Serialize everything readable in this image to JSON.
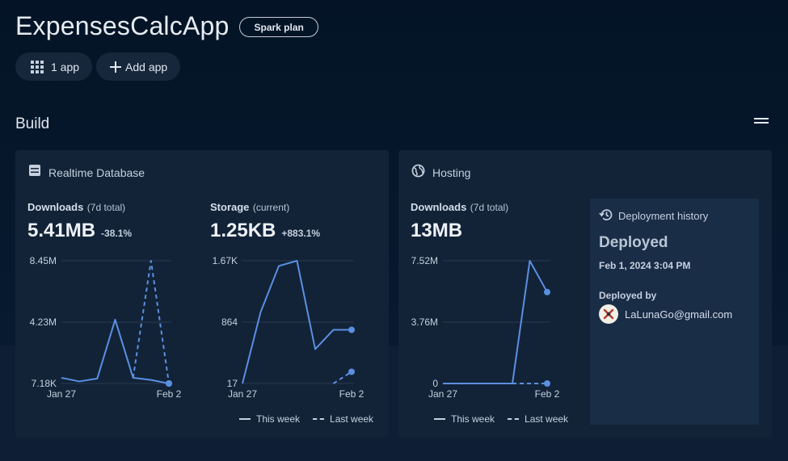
{
  "project": {
    "title": "ExpensesCalcApp",
    "plan": "Spark plan"
  },
  "pills": {
    "apps_label": "1 app",
    "add_label": "Add app"
  },
  "section": {
    "title": "Build"
  },
  "rtdb": {
    "title": "Realtime Database",
    "downloads": {
      "name": "Downloads",
      "sub": "(7d total)",
      "value": "5.41MB",
      "change": "-38.1%"
    },
    "storage": {
      "name": "Storage",
      "sub": "(current)",
      "value": "1.25KB",
      "change": "+883.1%"
    },
    "legend": {
      "this_week": "This week",
      "last_week": "Last week"
    }
  },
  "hosting": {
    "title": "Hosting",
    "downloads": {
      "name": "Downloads",
      "sub": "(7d total)",
      "value": "13MB"
    },
    "legend": {
      "this_week": "This week",
      "last_week": "Last week"
    },
    "deployment": {
      "title": "Deployment history",
      "status": "Deployed",
      "time": "Feb 1, 2024 3:04 PM",
      "by_label": "Deployed by",
      "user": "LaLunaGo@gmail.com"
    }
  },
  "colors": {
    "line": "#5b8fe0",
    "grid": "#2a3a52",
    "card": "#122338"
  },
  "chart_data": [
    {
      "type": "line",
      "name": "rtdb-downloads",
      "x": [
        "Jan 27",
        "Jan 28",
        "Jan 29",
        "Jan 30",
        "Jan 31",
        "Feb 1",
        "Feb 2"
      ],
      "x_tick_labels": [
        "Jan 27",
        "Feb 2"
      ],
      "y_tick_labels": [
        "8.45M",
        "4.23M",
        "7.18K"
      ],
      "ylim": [
        7180,
        8450000
      ],
      "series": [
        {
          "name": "This week",
          "values": [
            400000,
            150000,
            350000,
            4400000,
            400000,
            250000,
            7180
          ],
          "dashed": false
        },
        {
          "name": "Last week",
          "values": [
            null,
            null,
            null,
            null,
            400000,
            8450000,
            7180
          ],
          "dashed": true
        }
      ]
    },
    {
      "type": "line",
      "name": "rtdb-storage",
      "x": [
        "Jan 27",
        "Jan 28",
        "Jan 29",
        "Jan 30",
        "Jan 31",
        "Feb 1",
        "Feb 2"
      ],
      "x_tick_labels": [
        "Jan 27",
        "Feb 2"
      ],
      "y_tick_labels": [
        "1.67K",
        "864",
        "17"
      ],
      "ylim": [
        17,
        1670
      ],
      "series": [
        {
          "name": "This week",
          "values": [
            17,
            980,
            1600,
            1670,
            480,
            740,
            740
          ],
          "dashed": false
        },
        {
          "name": "Last week",
          "values": [
            null,
            null,
            null,
            null,
            null,
            17,
            175
          ],
          "dashed": true
        }
      ]
    },
    {
      "type": "line",
      "name": "hosting-downloads",
      "x": [
        "Jan 27",
        "Jan 28",
        "Jan 29",
        "Jan 30",
        "Jan 31",
        "Feb 1",
        "Feb 2"
      ],
      "x_tick_labels": [
        "Jan 27",
        "Feb 2"
      ],
      "y_tick_labels": [
        "7.52M",
        "3.76M",
        "0"
      ],
      "ylim": [
        0,
        7520000
      ],
      "series": [
        {
          "name": "This week",
          "values": [
            0,
            0,
            0,
            0,
            0,
            7520000,
            5600000
          ],
          "dashed": false
        },
        {
          "name": "Last week",
          "values": [
            null,
            null,
            null,
            null,
            0,
            0,
            0
          ],
          "dashed": true
        }
      ]
    }
  ]
}
